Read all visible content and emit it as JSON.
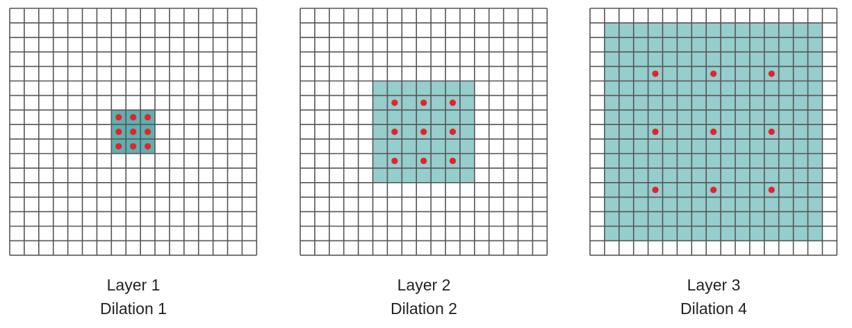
{
  "colors": {
    "grid_line": "#555555",
    "background": "#ffffff",
    "dot": "#e8202a",
    "level_1": "#96cdcd",
    "level_2": "#5fb0b0",
    "level_3": "#2b9797",
    "level_4": "#1a8a8a"
  },
  "grid_size": 17,
  "panels": [
    {
      "layer_label": "Layer 1",
      "dilation_label": "Dilation 1",
      "dilation": 1,
      "receptive_field_cells": 3
    },
    {
      "layer_label": "Layer 2",
      "dilation_label": "Dilation 2",
      "dilation": 2,
      "receptive_field_cells": 7
    },
    {
      "layer_label": "Layer 3",
      "dilation_label": "Dilation 4",
      "dilation": 4,
      "receptive_field_cells": 15
    }
  ]
}
